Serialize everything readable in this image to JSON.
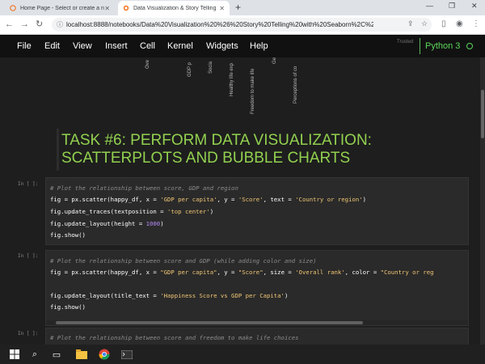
{
  "browser": {
    "tabs": [
      {
        "title": "Home Page - Select or create a n"
      },
      {
        "title": "Data Visualization & Story Telling"
      }
    ],
    "new_tab": "+",
    "url": "localhost:8888/notebooks/Data%20Visualization%20%26%20Story%20Telling%20with%20Seaborn%2C%20Matp..."
  },
  "menubar": {
    "items": [
      "File",
      "Edit",
      "View",
      "Insert",
      "Cell",
      "Kernel",
      "Widgets",
      "Help"
    ],
    "trusted": "Trusted",
    "kernel": "Python 3"
  },
  "chart_residue": {
    "labels": [
      "Ove",
      "GDP p",
      "Socia",
      "Healthy life exp",
      "Freedom to make life",
      "Ge",
      "Perceptions of co"
    ]
  },
  "markdown": {
    "title_line1": "TASK #6: PERFORM DATA VISUALIZATION:",
    "title_line2": "SCATTERPLOTS AND BUBBLE CHARTS"
  },
  "cells": [
    {
      "prompt": "In [ ]:",
      "comment": "# Plot the relationship between score, GDP and region",
      "code": [
        {
          "p1": "fig = px.scatter(happy_df, x = ",
          "s1": "'GDP per capita'",
          "p2": ", y = ",
          "s2": "'Score'",
          "p3": ", text = ",
          "s3": "'Country or region'",
          "p4": ")"
        },
        {
          "p1": "fig.update_traces(textposition = ",
          "s1": "'top center'",
          "p2": ")"
        },
        {
          "p1": "fig.update_layout(height = ",
          "n1": "1000",
          "p2": ")"
        },
        {
          "p1": "fig.show()"
        }
      ]
    },
    {
      "prompt": "In [ ]:",
      "comment": "# Plot the relationship between score and GDP (while adding color and size)",
      "code": [
        {
          "p1": "fig = px.scatter(happy_df, x = ",
          "s1": "\"GDP per capita\"",
          "p2": ", y = ",
          "s2": "\"Score\"",
          "p3": ", size = ",
          "s3": "'Overall rank'",
          "p4": ", color = ",
          "s4": "\"Country or reg"
        },
        {
          "p1": "fig.update_layout(title_text = ",
          "s1": "'Happiness Score vs GDP per Capita'",
          "p2": ")"
        },
        {
          "p1": "fig.show()"
        }
      ]
    },
    {
      "prompt": "In [ ]:",
      "comment": "# Plot the relationship between score and freedom to make life choices"
    }
  ],
  "colors": {
    "markdown_title": "#92d14f",
    "kernel": "#5cd65c",
    "string": "#f0c674",
    "number": "#b389f5"
  },
  "icons": [
    "jupyter-icon",
    "firefox-icon",
    "close-icon",
    "minimize-icon",
    "maximize-icon",
    "back-icon",
    "forward-icon",
    "reload-icon",
    "info-icon",
    "share-icon",
    "star-icon",
    "sidepanel-icon",
    "profile-icon",
    "menu-icon",
    "windows-icon",
    "search-icon",
    "taskview-icon",
    "file-explorer-icon",
    "chrome-icon",
    "terminal-icon"
  ]
}
